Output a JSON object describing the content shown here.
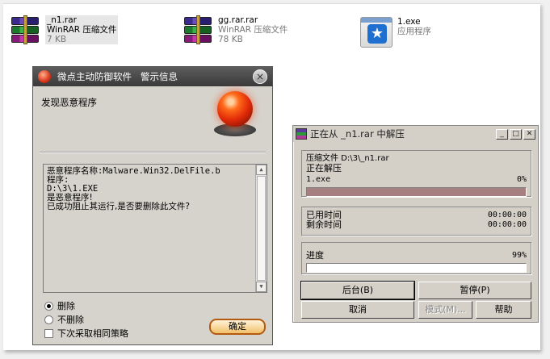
{
  "files": [
    {
      "name": "_n1.rar",
      "type": "WinRAR 压缩文件",
      "size": "7 KB",
      "icon": "rar-archive-icon"
    },
    {
      "name": "gg.rar.rar",
      "type": "WinRAR 压缩文件",
      "size": "78 KB",
      "icon": "rar-archive-icon"
    },
    {
      "name": "1.exe",
      "type": "应用程序",
      "icon": "application-icon"
    }
  ],
  "av_dialog": {
    "title": "微点主动防御软件   警示信息",
    "heading": "发现恶意程序",
    "message_lines": [
      "恶意程序名称:Malware.Win32.DelFile.b",
      "",
      "程序:",
      "D:\\3\\1.EXE",
      "是恶意程序!",
      "已成功阻止其运行,是否要删除此文件?"
    ],
    "options": {
      "delete": "删除",
      "no_delete": "不删除",
      "same_policy": "下次采取相同策略"
    },
    "ok_label": "确定"
  },
  "rar_dialog": {
    "title": "正在从 _n1.rar 中解压",
    "archive_line": "压缩文件 D:\\3\\_n1.rar",
    "status": "正在解压",
    "current_file": "1.exe",
    "file_percent": "0%",
    "file_progress": 1.0,
    "elapsed_label": "已用时间",
    "elapsed_value": "00:00:00",
    "remaining_label": "剩余时间",
    "remaining_value": "00:00:00",
    "progress_label": "进度",
    "progress_percent": "99%",
    "total_progress": 0.99,
    "buttons": {
      "background": "后台(B)",
      "pause": "暂停(P)",
      "cancel": "取消",
      "mode": "模式(M)...",
      "help": "帮助"
    }
  }
}
